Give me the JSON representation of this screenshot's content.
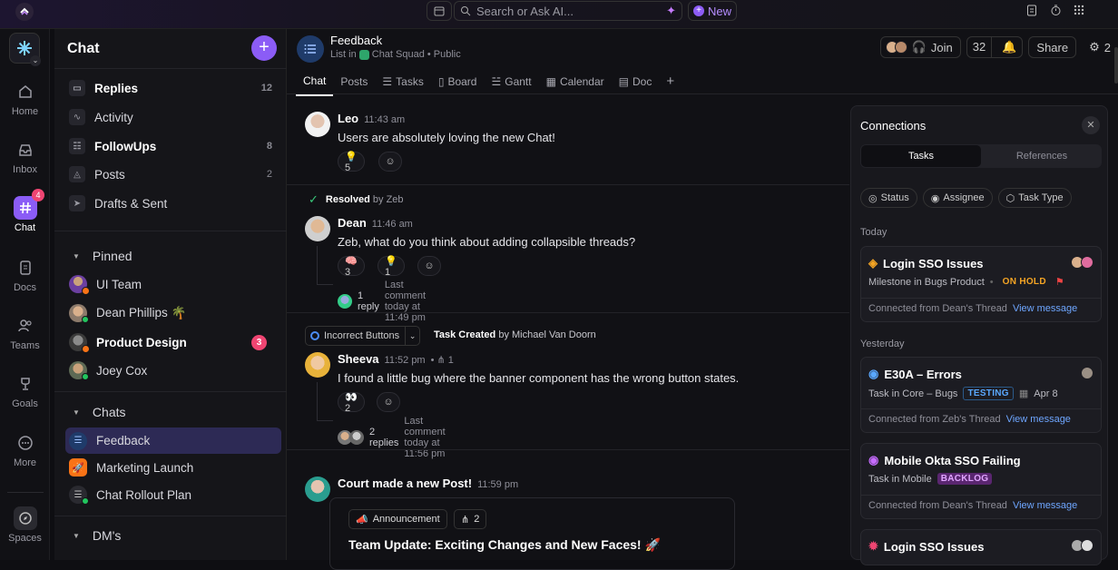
{
  "topbar": {
    "search_placeholder": "Search or Ask AI...",
    "new_label": "New"
  },
  "rail": {
    "items": [
      {
        "label": "Home",
        "icon": "home-icon"
      },
      {
        "label": "Inbox",
        "icon": "inbox-icon"
      },
      {
        "label": "Chat",
        "icon": "chat-icon",
        "badge": "4"
      },
      {
        "label": "Docs",
        "icon": "docs-icon"
      },
      {
        "label": "Teams",
        "icon": "teams-icon"
      },
      {
        "label": "Goals",
        "icon": "goals-icon"
      },
      {
        "label": "More",
        "icon": "more-icon"
      },
      {
        "label": "Spaces",
        "icon": "spaces-icon"
      }
    ]
  },
  "sidebar": {
    "title": "Chat",
    "top_items": [
      {
        "label": "Replies",
        "count": "12",
        "bold": true
      },
      {
        "label": "Activity",
        "count": ""
      },
      {
        "label": "FollowUps",
        "count": "8",
        "bold": true
      },
      {
        "label": "Posts",
        "count": "2"
      },
      {
        "label": "Drafts & Sent",
        "count": ""
      }
    ],
    "pinned_label": "Pinned",
    "pinned": [
      {
        "label": "UI Team"
      },
      {
        "label": "Dean Phillips 🌴"
      },
      {
        "label": "Product Design",
        "badge": "3"
      },
      {
        "label": "Joey Cox"
      }
    ],
    "chats_label": "Chats",
    "chats": [
      {
        "label": "Feedback"
      },
      {
        "label": "Marketing Launch"
      },
      {
        "label": "Chat Rollout Plan"
      }
    ],
    "dms_label": "DM's"
  },
  "header": {
    "title": "Feedback",
    "sub_prefix": "List in",
    "space": "Chat Squad",
    "visibility": "• Public",
    "join_label": "Join",
    "member_count": "32",
    "share_label": "Share",
    "share_count": "2",
    "tabs": [
      "Chat",
      "Posts",
      "Tasks",
      "Board",
      "Gantt",
      "Calendar",
      "Doc"
    ]
  },
  "messages": {
    "leo": {
      "name": "Leo",
      "time": "11:43 am",
      "text": "Users are absolutely loving the new Chat!",
      "react1": "💡 5"
    },
    "resolved": {
      "label": "Resolved",
      "by": "by Zeb"
    },
    "dean": {
      "name": "Dean",
      "time": "11:46 am",
      "text": "Zeb, what do you think about adding collapsible threads?",
      "react1": "🧠 3",
      "react2": "💡 1",
      "reply_count": "1 reply",
      "last": "Last comment today at 11:49 pm"
    },
    "task": {
      "chip": "Incorrect Buttons",
      "label": "Task Created",
      "by": "by Michael Van Doorn"
    },
    "sheeva": {
      "name": "Sheeva",
      "time": "11:52 pm",
      "subtask": "1",
      "text": "I found a little bug where the banner component has the wrong button states.",
      "react1": "👀 2",
      "reply_count": "2 replies",
      "last": "Last comment today at 11:56 pm"
    },
    "court": {
      "name": "Court made a new Post!",
      "time": "11:59 pm",
      "tag": "Announcement",
      "tag_count": "2",
      "post_title": "Team Update: Exciting Changes and New Faces! 🚀"
    }
  },
  "connections": {
    "title": "Connections",
    "tabs": [
      "Tasks",
      "References"
    ],
    "filters": [
      "Status",
      "Assignee",
      "Task Type"
    ],
    "today_label": "Today",
    "yesterday_label": "Yesterday",
    "cards": [
      {
        "title": "Login SSO Issues",
        "sub": "Milestone in Bugs Product",
        "tag": "ON HOLD",
        "tag_color": "#f5a524",
        "from": "Connected from Dean's Thread",
        "link": "View message"
      },
      {
        "title": "E30A – Errors",
        "sub": "Task in Core – Bugs",
        "tag": "TESTING",
        "tag_color": "#5aa8ff",
        "date": "Apr 8",
        "from": "Connected from Zeb's Thread",
        "link": "View message"
      },
      {
        "title": "Mobile Okta SSO Failing",
        "sub": "Task in Mobile",
        "tag": "BACKLOG",
        "tag_color": "#c66bff",
        "from": "Connected from Dean's Thread",
        "link": "View message"
      },
      {
        "title": "Login SSO Issues"
      }
    ]
  }
}
